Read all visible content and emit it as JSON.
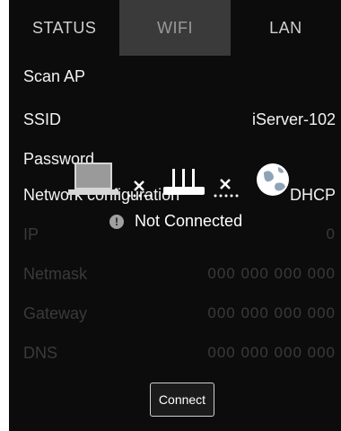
{
  "tabs": [
    {
      "label": "STATUS"
    },
    {
      "label": "WIFI"
    },
    {
      "label": "LAN"
    }
  ],
  "active_tab": "WIFI",
  "scan_ap": {
    "label": "Scan AP"
  },
  "ssid": {
    "label": "SSID",
    "value": "iServer-102"
  },
  "password": {
    "label": "Password",
    "value": ""
  },
  "network": {
    "label": "Network configuration",
    "value": "DHCP"
  },
  "ip": {
    "label": "IP",
    "value": "0"
  },
  "netmask": {
    "label": "Netmask",
    "value": "000 000 000 000"
  },
  "gateway": {
    "label": "Gateway",
    "value": "000 000 000 000"
  },
  "dns": {
    "label": "DNS",
    "value": "000 000 000 000"
  },
  "connection": {
    "status_text": "Not Connected",
    "icons": [
      "laptop-icon",
      "x-icon",
      "router-icon",
      "x-icon",
      "globe-icon"
    ]
  },
  "connect_button": {
    "label": "Connect"
  },
  "colors": {
    "background": "#0c0c0c",
    "active_tab": "#3a3a3a",
    "text": "#f2f2f2",
    "dim_text": "#3a3a3a"
  }
}
